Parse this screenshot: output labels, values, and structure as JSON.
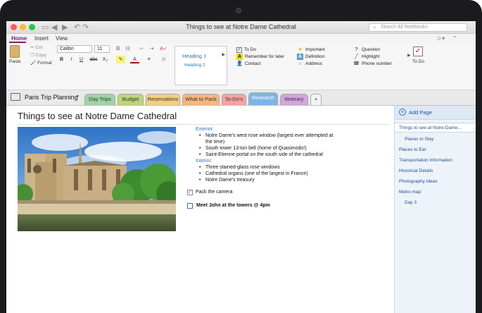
{
  "window": {
    "title": "Things to see at Notre Dame Cathedral",
    "search_placeholder": "Search All Notebooks"
  },
  "ribbon_tabs": [
    "Home",
    "Insert",
    "View"
  ],
  "clipboard": {
    "paste": "Paste",
    "cut": "Cut",
    "copy": "Copy",
    "format": "Format"
  },
  "font": {
    "family": "Calibri",
    "size": "11"
  },
  "format_buttons": {
    "bold": "B",
    "italic": "I",
    "underline": "U",
    "strike": "abc",
    "subscript": "X₂",
    "font_color": "A"
  },
  "styles": {
    "heading1": "Heading 1",
    "heading2": "Heading 2"
  },
  "tags": {
    "col1": [
      "To Do",
      "Remember for later",
      "Contact"
    ],
    "col2": [
      "Important",
      "Definition",
      "Address"
    ],
    "col3": [
      "Question",
      "Highlight",
      "Phone number"
    ],
    "todo_button": "To Do"
  },
  "notebook": {
    "name": "Paris Trip Planning"
  },
  "sections": [
    {
      "label": "Day Trips",
      "color": "#9fd3a6"
    },
    {
      "label": "Budget",
      "color": "#bcd67a"
    },
    {
      "label": "Reservations",
      "color": "#f4cf7f"
    },
    {
      "label": "What to Pack",
      "color": "#f7b67e"
    },
    {
      "label": "To-Do's",
      "color": "#f4a3a0"
    },
    {
      "label": "Research",
      "color": "#7fb4e5"
    },
    {
      "label": "Itinerary",
      "color": "#d4a5de"
    }
  ],
  "add_section": "+",
  "page": {
    "title": "Things to see at Notre Dame Cathedral",
    "exterior_heading": "Exterior:",
    "exterior_items": [
      "Notre Dame's west rose window (largest ever attempted at",
      "the time)",
      "South tower 13-ton bell (home of Quasimodo!)",
      "Saint-Etienne portal on the south side of the cathedral"
    ],
    "interior_heading": "Interior:",
    "interior_items": [
      "Three stained-glass rose windows",
      "Cathedral organs (one of the largest in France)",
      "Notre Dame's treasury"
    ],
    "todo1": "Pack the camera",
    "todo2": "Meet John at the towers @ 4pm"
  },
  "pages_panel": {
    "add_page": "Add Page",
    "items": [
      {
        "label": "Things to see at Notre Dame...",
        "indent": false,
        "selected": true
      },
      {
        "label": "Places to Stay",
        "indent": true
      },
      {
        "label": "Places to Eat",
        "indent": false
      },
      {
        "label": "Transportation Information",
        "indent": false
      },
      {
        "label": "Historical Details",
        "indent": false
      },
      {
        "label": "Photography Ideas",
        "indent": false
      },
      {
        "label": "Metro map",
        "indent": false
      },
      {
        "label": "Day 3",
        "indent": true
      }
    ]
  },
  "colors": {
    "accent": "#7a1f6e",
    "link": "#2e75b6"
  }
}
